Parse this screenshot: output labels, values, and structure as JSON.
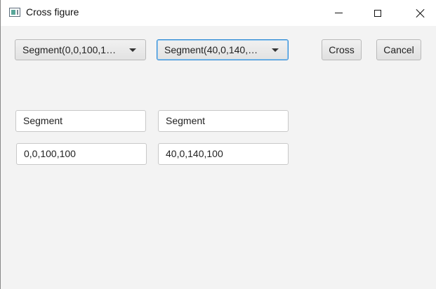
{
  "window": {
    "title": "Cross figure",
    "icons": {
      "app": "app-window-icon",
      "minimize": "minimize-icon",
      "maximize": "maximize-icon",
      "close": "close-icon"
    }
  },
  "toolbar": {
    "combo1_value": "Segment(0,0,100,1…",
    "combo2_value": "Segment(40,0,140,…",
    "cross_label": "Cross",
    "cancel_label": "Cancel"
  },
  "figures": {
    "first_type": "Segment",
    "second_type": "Segment",
    "first_coords": "0,0,100,100",
    "second_coords": "40,0,140,100"
  },
  "colors": {
    "focus_border": "#2f8ad4",
    "window_bg": "#f3f3f3"
  }
}
